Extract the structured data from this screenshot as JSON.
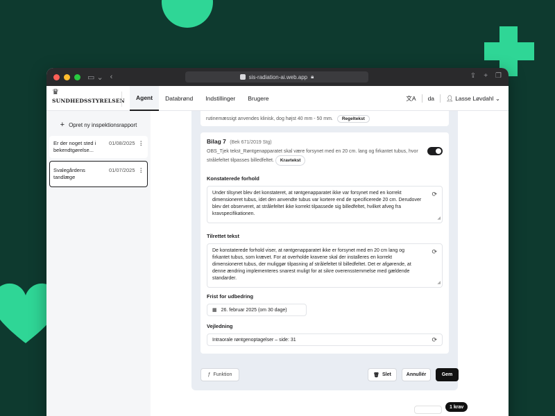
{
  "browser": {
    "url": "sis-radiation-ai.web.app"
  },
  "app": {
    "brand": "SUNDHEDSSTYRELSEN",
    "tabs": [
      "Agent",
      "Databrønd",
      "Indstillinger",
      "Brugere"
    ],
    "active_tab": "Agent",
    "language": "da",
    "user": "Lasse Løvdahl"
  },
  "sidebar": {
    "new_report": "Opret ny inspektionsrapport",
    "reports": [
      {
        "name": "Er der noget sted i bekendtgørelse...",
        "date": "01/08/2025"
      },
      {
        "name": "Svalegårdens tandlæge",
        "date": "01/07/2025"
      }
    ]
  },
  "prev_card": {
    "text": "rutinemæssigt anvendes klinisk, dog højst 40 mm - 50 mm.",
    "chip": "Regeltekst"
  },
  "card": {
    "title": "Bilag 7",
    "ref": "(Bek 671/2019 Stg)",
    "description": "OBS_Tjek tekst_Røntgenapparatet skal være forsynet med en 20 cm. lang og firkantet tubus, hvor strålefeltet tilpasses billedfeltet.",
    "chip": "Kravtekst",
    "toggle_on": true,
    "fields": {
      "konstaterede_label": "Konstaterede forhold",
      "konstaterede_text": "Under tilsynet blev det konstateret, at røntgenapparatet ikke var forsynet med en korrekt dimensioneret tubus, idet den anvendte tubus var kortere end de specificerede 20 cm. Derudover blev det observeret, at strålefeltet ikke korrekt tilpassede sig billedfeltet, hvilket afveg fra kravspecifikationen.",
      "tilrettet_label": "Tilrettet tekst",
      "tilrettet_text": "De konstaterede forhold viser, at røntgenapparatet ikke er forsynet med en 20 cm lang og firkantet tubus, som krævet. For at overholde kravene skal der installeres en korrekt dimensioneret tubus, der muliggør tilpasning af strålefeltet til billedfeltet. Det er afgørende, at denne ændring implementeres snarest muligt for at sikre overensstemmelse med gældende standarder.",
      "frist_label": "Frist for udbedring",
      "frist_value": "26. februar 2025 (om 30 dage)",
      "vejledning_label": "Vejledning",
      "vejledning_value": "Intraorale røntgenoptagelser – side: 31"
    }
  },
  "footer": {
    "funktion": "Funktion",
    "slet": "Slet",
    "annuller": "Annullér",
    "gem": "Gem"
  },
  "krav_badge": "1 krav",
  "colors": {
    "background": "#0e3a2f",
    "accent": "#2fd696",
    "primary": "#111111"
  }
}
